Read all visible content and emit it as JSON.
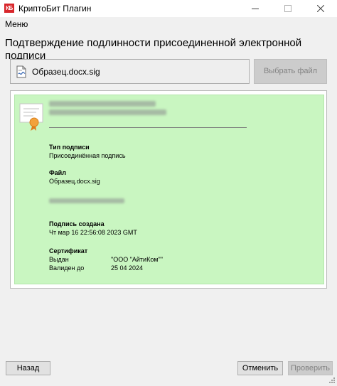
{
  "window": {
    "app_icon_text": "КБ",
    "title": "КриптоБит Плагин"
  },
  "menu": {
    "label": "Меню"
  },
  "heading": "Подтверждение подлинности присоединенной электронной подписи",
  "file": {
    "name": "Образец.docx.sig",
    "choose_label": "Выбрать файл"
  },
  "details": {
    "signature_type_label": "Тип подписи",
    "signature_type_value": "Присоединённая подпись",
    "file_label": "Файл",
    "file_value": "Образец.docx.sig",
    "created_label": "Подпись создана",
    "created_value": "Чт мар 16 22:56:08 2023 GMT",
    "certificate_label": "Сертификат",
    "issued_label": "Выдан",
    "issued_value": "\"ООО \"АйтиКом\"\"",
    "valid_label": "Валиден до",
    "valid_value": "25 04 2024"
  },
  "footer": {
    "back_label": "Назад",
    "cancel_label": "Отменить",
    "verify_label": "Проверить"
  },
  "colors": {
    "success_bg": "#c9f6c1",
    "app_icon": "#d8262b"
  }
}
